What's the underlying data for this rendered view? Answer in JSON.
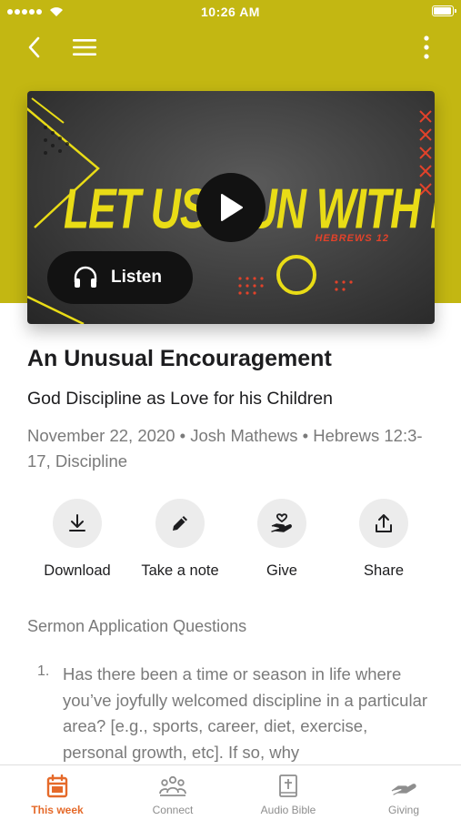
{
  "status_bar": {
    "time": "10:26 AM"
  },
  "nav": {
    "back_icon": "chevron-left-icon",
    "menu_icon": "hamburger-menu-icon",
    "more_icon": "vertical-dots-icon"
  },
  "hero": {
    "artwork_title": "LET US RUN WITH ENDURANCE",
    "artwork_subtitle": "HEBREWS 12",
    "listen_label": "Listen"
  },
  "sermon": {
    "title": "An Unusual Encouragement",
    "subtitle": "God Discipline as Love for his Children",
    "meta": "November 22, 2020 • Josh Mathews • Hebrews 12:3-17, Discipline"
  },
  "actions": [
    {
      "label": "Download",
      "icon": "download-icon"
    },
    {
      "label": "Take a note",
      "icon": "pencil-icon"
    },
    {
      "label": "Give",
      "icon": "give-hand-heart-icon"
    },
    {
      "label": "Share",
      "icon": "share-icon"
    }
  ],
  "content": {
    "section_heading": "Sermon Application Questions",
    "questions": [
      {
        "number": "1.",
        "text": "Has there been a time or season in life where you’ve joyfully welcomed discipline in a particular area? [e.g., sports, career, diet, exercise, personal growth, etc]. If so, why"
      }
    ]
  },
  "tabs": [
    {
      "label": "This week",
      "icon": "calendar-icon",
      "active": true
    },
    {
      "label": "Connect",
      "icon": "people-group-icon",
      "active": false
    },
    {
      "label": "Audio Bible",
      "icon": "bible-icon",
      "active": false
    },
    {
      "label": "Giving",
      "icon": "giving-hand-icon",
      "active": false
    }
  ],
  "colors": {
    "header": "#c3b712",
    "accent": "#e56a2a",
    "artwork_yellow": "#e9dc16",
    "artwork_red": "#e2422a"
  }
}
